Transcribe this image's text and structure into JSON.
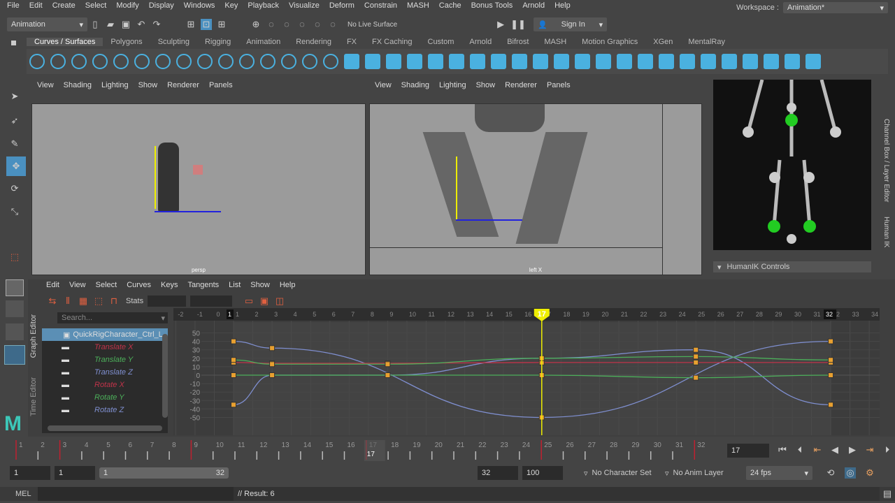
{
  "menus": [
    "File",
    "Edit",
    "Create",
    "Select",
    "Modify",
    "Display",
    "Windows",
    "Key",
    "Playback",
    "Visualize",
    "Deform",
    "Constrain",
    "MASH",
    "Cache",
    "Bonus Tools",
    "Arnold",
    "Help"
  ],
  "workspace": {
    "label": "Workspace :",
    "value": "Animation*"
  },
  "toolbar": {
    "mode": "Animation",
    "live_surface": "No Live Surface",
    "sign_in": "Sign In"
  },
  "shelf_tabs": [
    "Curves / Surfaces",
    "Polygons",
    "Sculpting",
    "Rigging",
    "Animation",
    "Rendering",
    "FX",
    "FX Caching",
    "Custom",
    "Arnold",
    "Bifrost",
    "MASH",
    "Motion Graphics",
    "XGen",
    "MentalRay"
  ],
  "viewport_menu": [
    "View",
    "Shading",
    "Lighting",
    "Show",
    "Renderer",
    "Panels"
  ],
  "viewports": [
    {
      "label": "persp"
    },
    {
      "label": "left X"
    }
  ],
  "right_panel": {
    "humanik_controls": "HumanIK Controls",
    "side_tabs": [
      "Channel Box / Layer Editor",
      "Human IK"
    ]
  },
  "graph_editor": {
    "menus": [
      "Edit",
      "View",
      "Select",
      "Curves",
      "Keys",
      "Tangents",
      "List",
      "Show",
      "Help"
    ],
    "stats_label": "Stats",
    "search_placeholder": "Search...",
    "side_tabs": [
      "Graph Editor",
      "Time Editor"
    ],
    "node": "QuickRigCharacter_Ctrl_L",
    "channels": [
      {
        "name": "Translate X",
        "color": "#c0334a"
      },
      {
        "name": "Translate Y",
        "color": "#4caf5a"
      },
      {
        "name": "Translate Z",
        "color": "#7f8fd0"
      },
      {
        "name": "Rotate X",
        "color": "#c0334a"
      },
      {
        "name": "Rotate Y",
        "color": "#4caf5a"
      },
      {
        "name": "Rotate Z",
        "color": "#7f8fd0"
      }
    ],
    "frame_ticks": [
      "-2",
      "-1",
      "0",
      "1",
      "1",
      "2",
      "3",
      "4",
      "5",
      "6",
      "7",
      "8",
      "9",
      "10",
      "11",
      "12",
      "13",
      "14",
      "15",
      "16",
      "17",
      "18",
      "19",
      "20",
      "21",
      "22",
      "23",
      "24",
      "25",
      "26",
      "27",
      "28",
      "29",
      "30",
      "31",
      "32",
      "33",
      "34"
    ],
    "value_ticks": [
      "50",
      "40",
      "30",
      "20",
      "10",
      "0",
      "-10",
      "-20",
      "-30",
      "-40",
      "-50"
    ],
    "current_frame": "17",
    "end_marker": "32",
    "start_marker": "1",
    "curves": [
      {
        "color": "#7f8fd0",
        "keys": [
          [
            1,
            40
          ],
          [
            3,
            32
          ],
          [
            17,
            -50
          ],
          [
            32,
            40
          ]
        ]
      },
      {
        "color": "#7f8fd0",
        "keys": [
          [
            1,
            -35
          ],
          [
            3,
            0
          ],
          [
            9,
            0
          ],
          [
            17,
            20
          ],
          [
            25,
            30
          ],
          [
            32,
            -35
          ]
        ]
      },
      {
        "color": "#c0334a",
        "keys": [
          [
            1,
            15
          ],
          [
            3,
            14
          ],
          [
            9,
            14
          ],
          [
            17,
            15
          ],
          [
            25,
            15
          ],
          [
            32,
            15
          ]
        ]
      },
      {
        "color": "#4caf5a",
        "keys": [
          [
            1,
            18
          ],
          [
            3,
            13
          ],
          [
            9,
            13
          ],
          [
            17,
            20
          ],
          [
            25,
            22
          ],
          [
            32,
            18
          ]
        ]
      },
      {
        "color": "#4caf5a",
        "keys": [
          [
            1,
            0
          ],
          [
            3,
            0
          ],
          [
            9,
            0
          ],
          [
            17,
            0
          ],
          [
            25,
            -3
          ],
          [
            32,
            0
          ]
        ]
      }
    ]
  },
  "timeline": {
    "ticks": [
      "1",
      "2",
      "3",
      "4",
      "5",
      "6",
      "7",
      "8",
      "9",
      "10",
      "11",
      "12",
      "13",
      "14",
      "15",
      "16",
      "17",
      "18",
      "19",
      "20",
      "21",
      "22",
      "23",
      "24",
      "25",
      "26",
      "27",
      "28",
      "29",
      "30",
      "31",
      "32"
    ],
    "current": "17",
    "current_field": "17",
    "key_frames": [
      1,
      3,
      9,
      17,
      25,
      32
    ]
  },
  "range": {
    "start": "1",
    "playback_start": "1",
    "slider_start": "1",
    "slider_end": "32",
    "playback_end": "32",
    "end": "100",
    "character_set": "No Character Set",
    "anim_layer": "No Anim Layer",
    "fps": "24 fps"
  },
  "command": {
    "lang": "MEL",
    "result": "// Result: 6"
  }
}
